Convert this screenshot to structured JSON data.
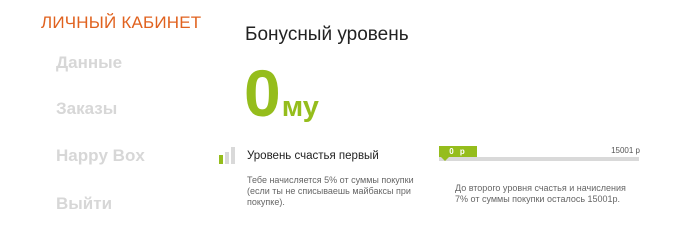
{
  "nav": {
    "title": "ЛИЧНЫЙ КАБИНЕТ",
    "items": [
      {
        "label": "Данные"
      },
      {
        "label": "Заказы"
      },
      {
        "label": "Happy Box"
      },
      {
        "label": "Выйти"
      }
    ]
  },
  "main": {
    "title": "Бонусный уровень",
    "balance": {
      "value": "0",
      "currency": "му"
    },
    "level": {
      "icon": "signal-bars-icon",
      "name": "Уровень счастья первый",
      "description": "Тебе начисляется 5% от суммы покупки (если ты не списываешь майбаксы при покупке)."
    },
    "progress": {
      "current_label": "0 р",
      "max_label": "15001 р",
      "current": 0,
      "max": 15001,
      "description": "До второго уровня счастья и начисления 7% от суммы покупки осталось 15001р."
    }
  },
  "colors": {
    "accent_orange": "#e0621f",
    "accent_green": "#95bd1c",
    "nav_inactive": "#d7d7d7",
    "track_gray": "#d9d9d9"
  }
}
